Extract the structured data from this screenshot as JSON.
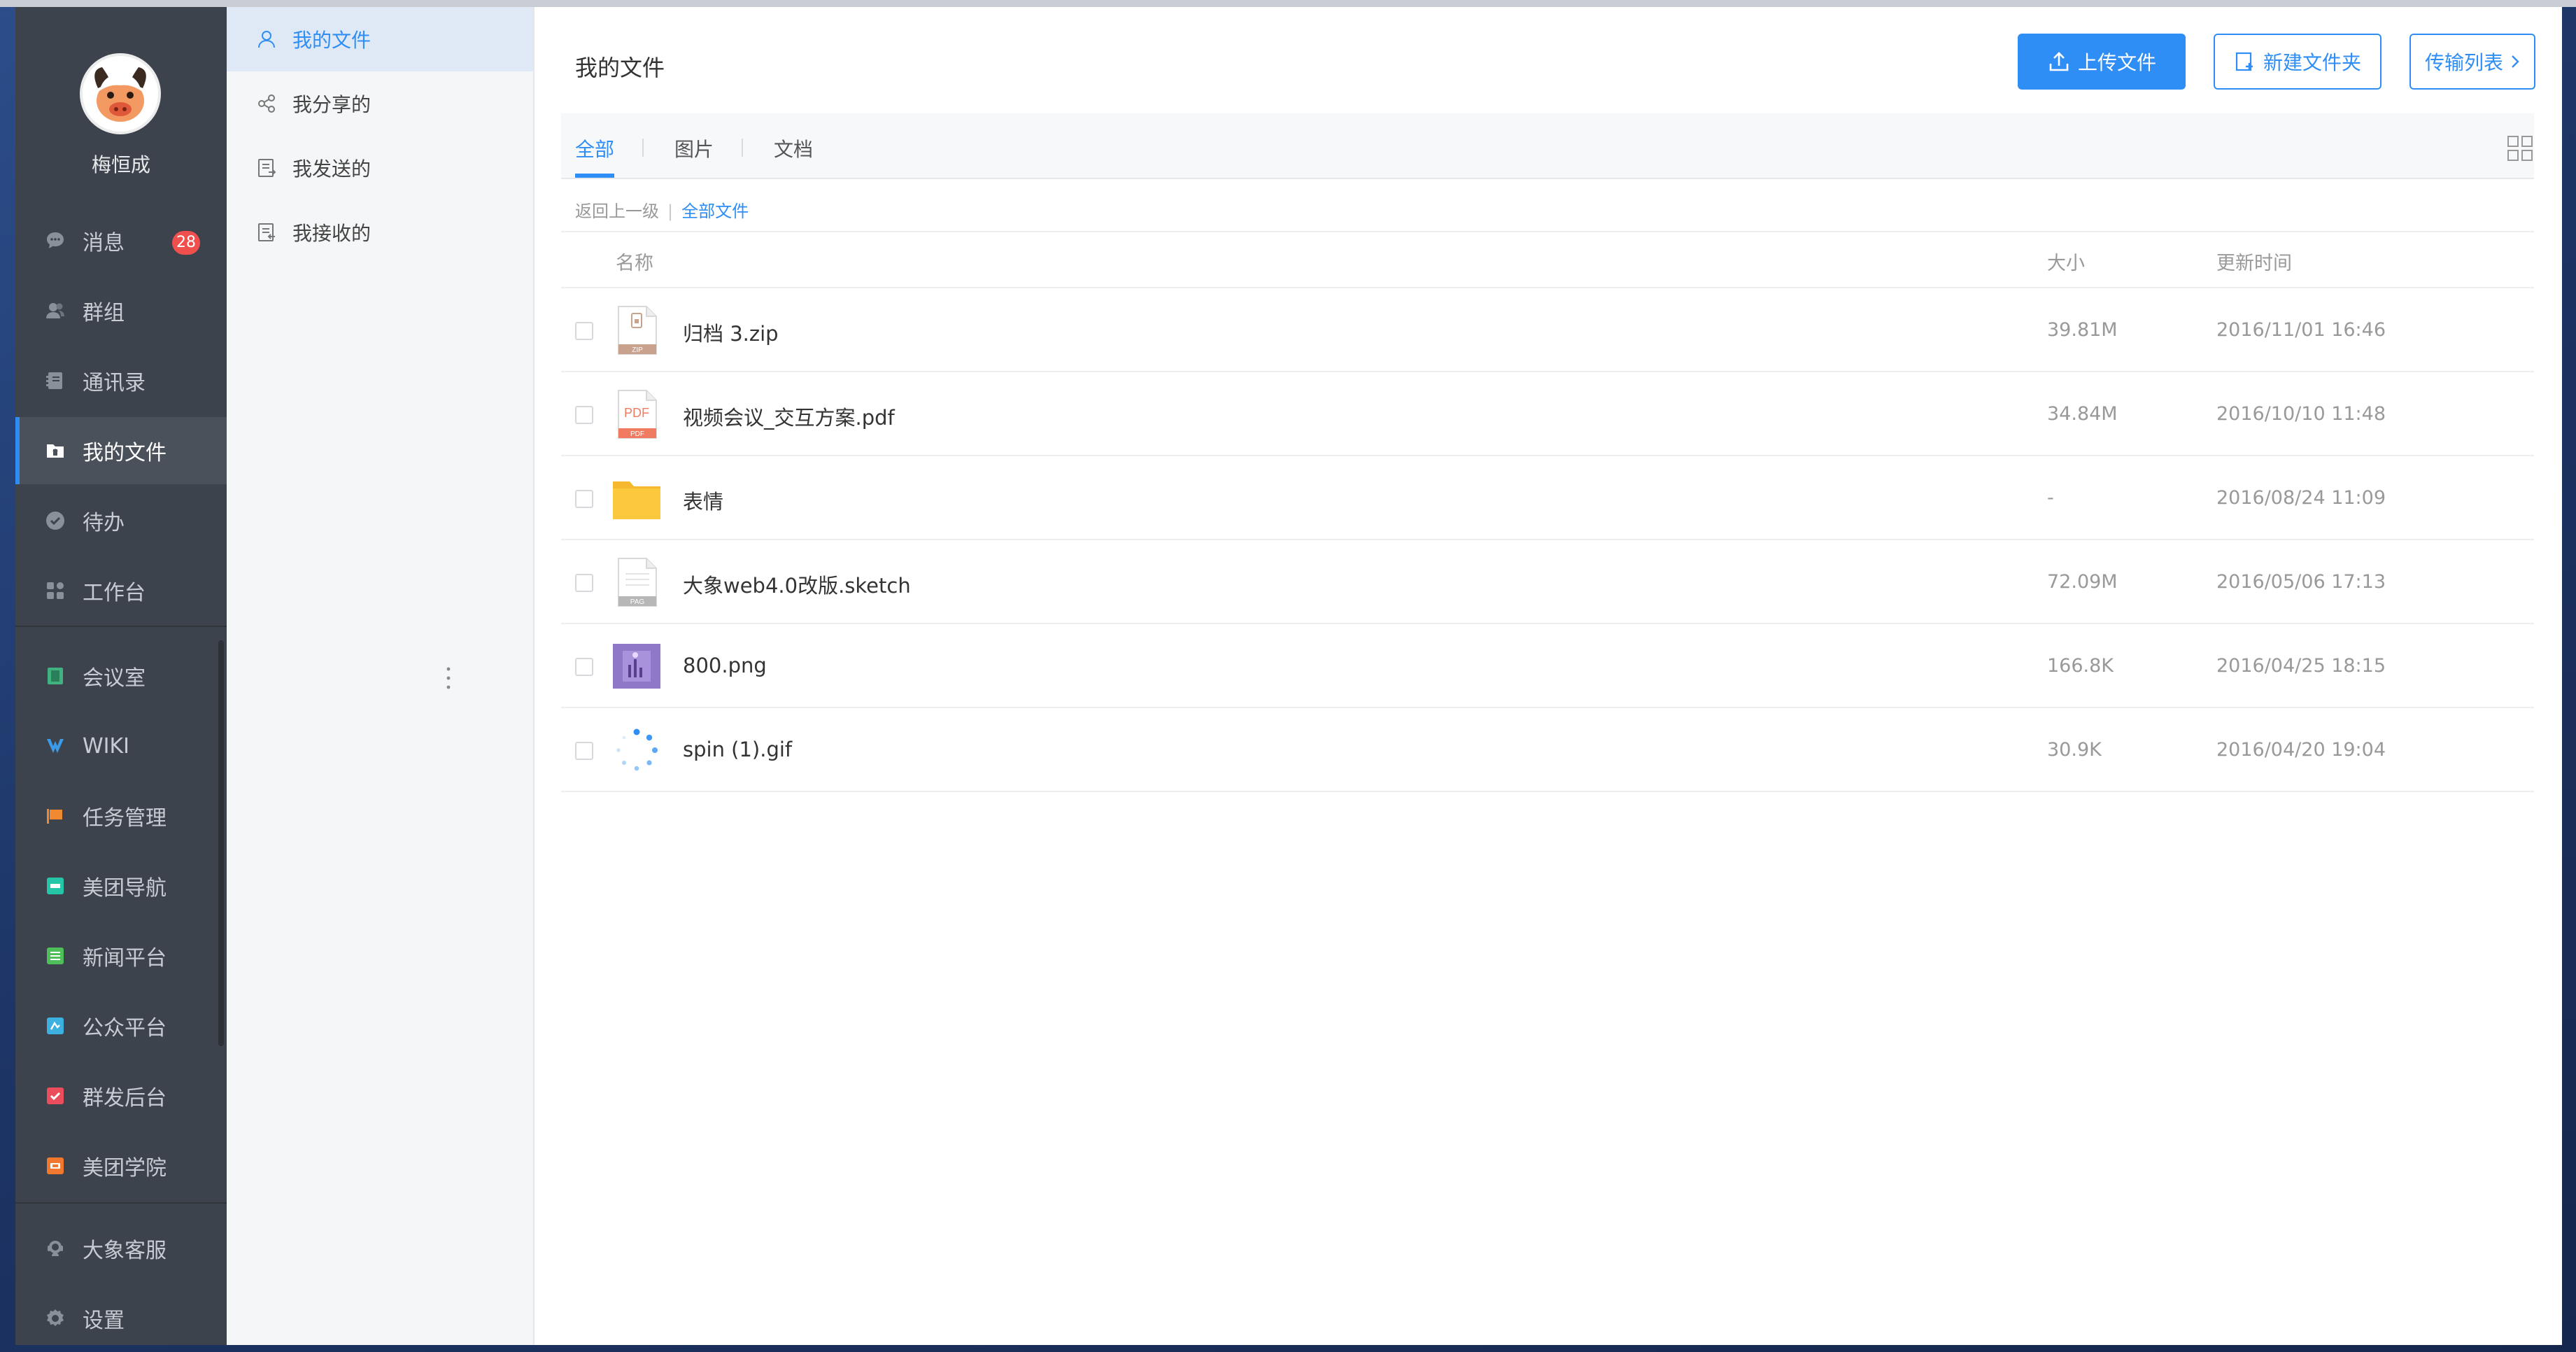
{
  "user": {
    "name": "梅恒成"
  },
  "nav": {
    "items": [
      {
        "label": "消息",
        "badge": "28",
        "icon": "chat-bubble-icon"
      },
      {
        "label": "群组",
        "icon": "group-icon"
      },
      {
        "label": "通讯录",
        "icon": "contacts-book-icon"
      },
      {
        "label": "我的文件",
        "icon": "folder-file-icon",
        "active": true
      },
      {
        "label": "待办",
        "icon": "check-circle-icon"
      },
      {
        "label": "工作台",
        "icon": "workbench-grid-icon"
      },
      {
        "label": "会议室",
        "icon": "meeting-room-icon"
      },
      {
        "label": "WIKI",
        "icon": "wiki-icon"
      },
      {
        "label": "任务管理",
        "icon": "flag-icon"
      },
      {
        "label": "美团导航",
        "icon": "nav-app-icon"
      },
      {
        "label": "新闻平台",
        "icon": "news-app-icon"
      },
      {
        "label": "公众平台",
        "icon": "public-app-icon"
      },
      {
        "label": "群发后台",
        "icon": "broadcast-app-icon"
      },
      {
        "label": "美团学院",
        "icon": "academy-app-icon"
      },
      {
        "label": "大象客服",
        "icon": "customer-service-icon"
      },
      {
        "label": "设置",
        "icon": "gear-icon"
      }
    ]
  },
  "sub": {
    "items": [
      {
        "label": "我的文件",
        "icon": "person-icon",
        "active": true
      },
      {
        "label": "我分享的",
        "icon": "share-icon"
      },
      {
        "label": "我发送的",
        "icon": "send-doc-icon"
      },
      {
        "label": "我接收的",
        "icon": "receive-doc-icon"
      }
    ]
  },
  "main": {
    "title": "我的文件",
    "buttons": {
      "upload": "上传文件",
      "new_folder": "新建文件夹",
      "transfer": "传输列表"
    },
    "tabs": [
      {
        "label": "全部",
        "active": true
      },
      {
        "label": "图片"
      },
      {
        "label": "文档"
      }
    ],
    "breadcrumb": {
      "back": "返回上一级",
      "separator": "|",
      "current": "全部文件"
    },
    "columns": {
      "name": "名称",
      "size": "大小",
      "time": "更新时间"
    },
    "files": [
      {
        "name": "归档 3.zip",
        "size": "39.81M",
        "time": "2016/11/01 16:46",
        "type": "zip",
        "icon": "zip-file-icon",
        "tag": "ZIP"
      },
      {
        "name": "视频会议_交互方案.pdf",
        "size": "34.84M",
        "time": "2016/10/10 11:48",
        "type": "pdf",
        "icon": "pdf-file-icon",
        "tag": "PDF"
      },
      {
        "name": "表情",
        "size": "-",
        "time": "2016/08/24 11:09",
        "type": "folder",
        "icon": "folder-icon"
      },
      {
        "name": "大象web4.0改版.sketch",
        "size": "72.09M",
        "time": "2016/05/06 17:13",
        "type": "generic",
        "icon": "generic-file-icon",
        "tag": "PAG"
      },
      {
        "name": "800.png",
        "size": "166.8K",
        "time": "2016/04/25 18:15",
        "type": "image",
        "icon": "image-thumbnail-icon"
      },
      {
        "name": "spin (1).gif",
        "size": "30.9K",
        "time": "2016/04/20 19:04",
        "type": "gif",
        "icon": "spinner-icon"
      }
    ]
  },
  "colors": {
    "accent": "#2f8ef5",
    "nav_bg": "#3d434c",
    "badge": "#f0504d",
    "folder": "#f5b82e"
  }
}
